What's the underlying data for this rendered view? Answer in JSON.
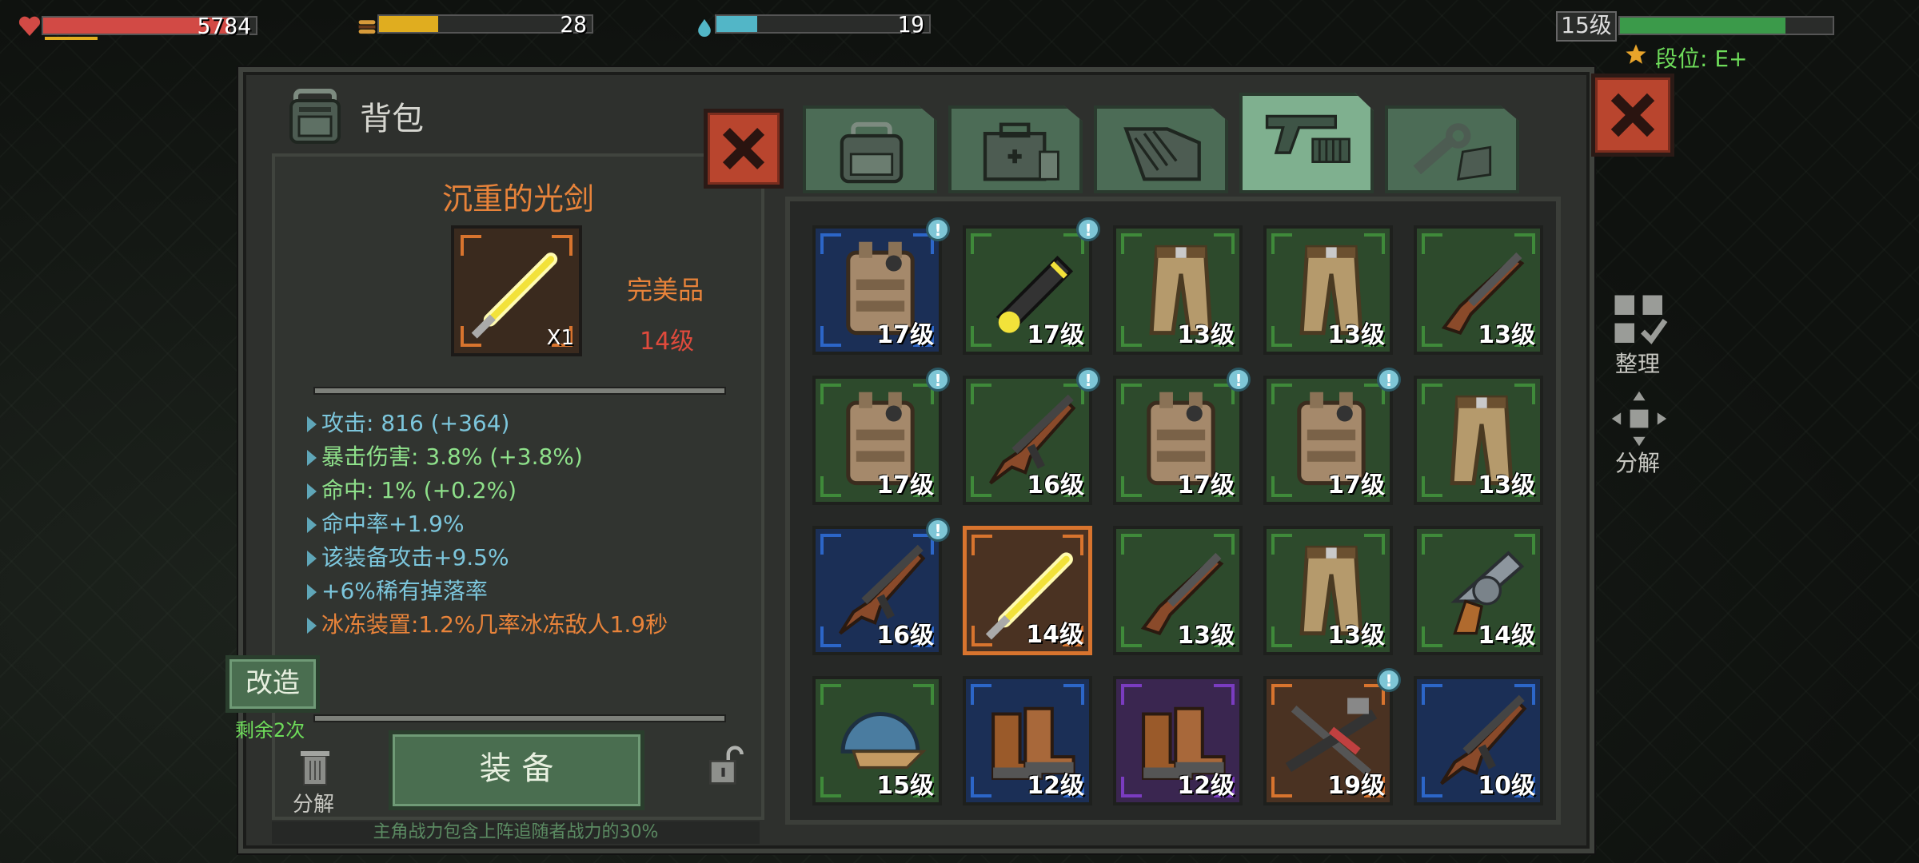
{
  "hud": {
    "health": {
      "value": "5784",
      "fill": 0.88,
      "color": "#d24a45"
    },
    "food": {
      "value": "28",
      "fill": 0.28,
      "color": "#e0ad1f"
    },
    "water": {
      "value": "19",
      "fill": 0.19,
      "color": "#52b6c7"
    },
    "level": {
      "label": "15级",
      "fill": 0.78
    },
    "rank": {
      "label": "段位: E+"
    }
  },
  "inventory": {
    "title": "背包",
    "tabs": [
      {
        "icon": "backpack-icon",
        "active": false
      },
      {
        "icon": "medkit-icon",
        "active": false
      },
      {
        "icon": "armor-icon",
        "active": false
      },
      {
        "icon": "gun-ammo-icon",
        "active": true
      },
      {
        "icon": "tools-icon",
        "active": false
      }
    ],
    "selected_item": {
      "name": "沉重的光剑",
      "quality": "完美品",
      "level": "14级",
      "count": "X1",
      "stats": [
        {
          "text": "攻击: 816 (+364)",
          "color": "#7cc6dc"
        },
        {
          "text": "暴击伤害: 3.8% (+3.8%)",
          "color": "#8ee08a"
        },
        {
          "text": "命中: 1% (+0.2%)",
          "color": "#8ee08a"
        },
        {
          "text": "命中率+1.9%",
          "color": "#7cc6dc"
        },
        {
          "text": "该装备攻击+9.5%",
          "color": "#7cc6dc"
        },
        {
          "text": "+6%稀有掉落率",
          "color": "#7cc6dc"
        },
        {
          "text": "冰冻装置:1.2%几率冰冻敌人1.9秒",
          "color": "#e8833a"
        }
      ]
    },
    "modify_label": "改造",
    "remaining_label": "剩余2次",
    "discard_label": "分解",
    "equip_label": "装 备",
    "footer_note": "主角战力包含上阵追随者战力的30%",
    "side": {
      "sort_label": "整理",
      "disassemble_label": "分解"
    },
    "items": [
      {
        "icon": "vest-icon",
        "level": "17级",
        "rarity": "blue",
        "new": true
      },
      {
        "icon": "plasma-gun-icon",
        "level": "17级",
        "rarity": "green",
        "new": true
      },
      {
        "icon": "pants-icon",
        "level": "13级",
        "rarity": "green",
        "new": false
      },
      {
        "icon": "pants-icon",
        "level": "13级",
        "rarity": "green",
        "new": false
      },
      {
        "icon": "shotgun-icon",
        "level": "13级",
        "rarity": "green",
        "new": false
      },
      {
        "icon": "vest-icon",
        "level": "17级",
        "rarity": "green",
        "new": true
      },
      {
        "icon": "ak-rifle-icon",
        "level": "16级",
        "rarity": "green",
        "new": true
      },
      {
        "icon": "vest-icon",
        "level": "17级",
        "rarity": "green",
        "new": true
      },
      {
        "icon": "vest-icon",
        "level": "17级",
        "rarity": "green",
        "new": true
      },
      {
        "icon": "pants-icon",
        "level": "13级",
        "rarity": "green",
        "new": false
      },
      {
        "icon": "ak-rifle-icon",
        "level": "16级",
        "rarity": "blue",
        "new": true
      },
      {
        "icon": "lightsaber-icon",
        "level": "14级",
        "rarity": "orange",
        "new": false,
        "selected": true
      },
      {
        "icon": "shotgun-icon",
        "level": "13级",
        "rarity": "green",
        "new": false
      },
      {
        "icon": "pants-icon",
        "level": "13级",
        "rarity": "green",
        "new": false
      },
      {
        "icon": "revolver-icon",
        "level": "14级",
        "rarity": "green",
        "new": false
      },
      {
        "icon": "cap-icon",
        "level": "15级",
        "rarity": "green",
        "new": false
      },
      {
        "icon": "boots-icon",
        "level": "12级",
        "rarity": "blue",
        "new": false
      },
      {
        "icon": "boots-icon",
        "level": "12级",
        "rarity": "purple",
        "new": false
      },
      {
        "icon": "crossbow-icon",
        "level": "19级",
        "rarity": "orange",
        "new": true
      },
      {
        "icon": "ak-rifle-icon",
        "level": "10级",
        "rarity": "blue",
        "new": false
      }
    ],
    "rarity_colors": {
      "green": "#3f8a3a",
      "blue": "#2c66c8",
      "purple": "#7a3cc0",
      "orange": "#d8742e"
    },
    "slot_bg": {
      "green": "#2d4a2c",
      "blue": "#1b2f56",
      "purple": "#3a2650",
      "orange": "#4a3222"
    }
  }
}
